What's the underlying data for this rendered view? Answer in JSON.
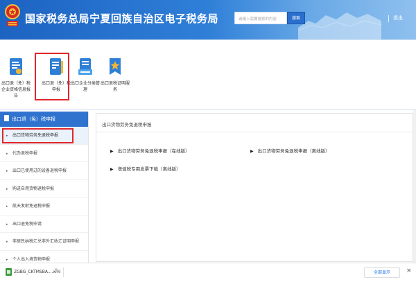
{
  "header": {
    "title": "国家税务总局宁夏回族自治区电子税务局",
    "search_placeholder": "请输入需要搜索的内容",
    "search_button": "搜索",
    "logout": "退出"
  },
  "toolbar": {
    "items": [
      {
        "label": "出口退（免）税企业资格信息报告",
        "icon": "report-form-icon"
      },
      {
        "label": "出口退（免）税申报",
        "icon": "declaration-form-icon",
        "highlighted": true
      },
      {
        "label": "出口企业分类管理",
        "icon": "classification-icon"
      },
      {
        "label": "出口退税证明服务",
        "icon": "certificate-service-icon"
      }
    ]
  },
  "sidebar": {
    "header": "出口退（免）税申报",
    "items": [
      {
        "label": "出口货物劳务免退税申报",
        "active": true
      },
      {
        "label": "代办退税申报"
      },
      {
        "label": "出口已使用过的设备退税申报"
      },
      {
        "label": "购进自用货物退税申报"
      },
      {
        "label": "航天发射免退税申报"
      },
      {
        "label": "出口退免税申请"
      },
      {
        "label": "非居民纳税汇兑非外汇收汇证明申报"
      },
      {
        "label": "个人出入境货物申报"
      }
    ]
  },
  "main": {
    "title": "出口货物劳务免退税申报",
    "links": [
      {
        "label": "出口货物劳务免退税申报（在线版）"
      },
      {
        "label": "出口货物劳务免退税申报（离线版）"
      },
      {
        "label": "增值税专用发票下载（离线版）"
      }
    ]
  },
  "download_bar": {
    "file_name": "ZGBG_CKTMSBA....xml",
    "chevron": "^",
    "show_all": "全部显示",
    "close": "×"
  },
  "colors": {
    "header_blue": "#1d63c2",
    "sidebar_head_blue": "#2f73cf",
    "highlight_red": "#e0262c"
  }
}
